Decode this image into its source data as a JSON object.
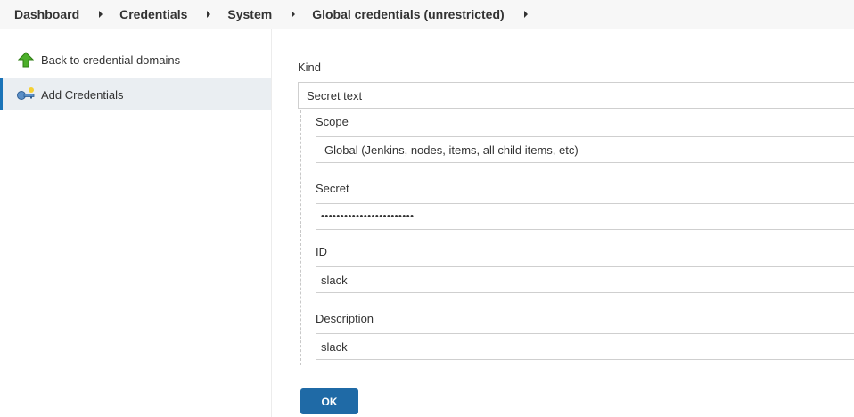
{
  "breadcrumb": {
    "items": [
      "Dashboard",
      "Credentials",
      "System",
      "Global credentials (unrestricted)"
    ]
  },
  "sidebar": {
    "items": [
      {
        "label": "Back to credential domains",
        "icon": "up-arrow-icon"
      },
      {
        "label": "Add Credentials",
        "icon": "key-icon",
        "active": true
      }
    ]
  },
  "form": {
    "kind": {
      "label": "Kind",
      "value": "Secret text"
    },
    "scope": {
      "label": "Scope",
      "value": "Global (Jenkins, nodes, items, all child items, etc)"
    },
    "secret": {
      "label": "Secret",
      "value": "••••••••••••••••••••••••"
    },
    "id": {
      "label": "ID",
      "value": "slack"
    },
    "description": {
      "label": "Description",
      "value": "slack"
    },
    "ok_label": "OK"
  },
  "colors": {
    "accent": "#1f6aa6",
    "active_bg": "#eaeef2",
    "breadcrumb_bg": "#f7f7f7"
  }
}
